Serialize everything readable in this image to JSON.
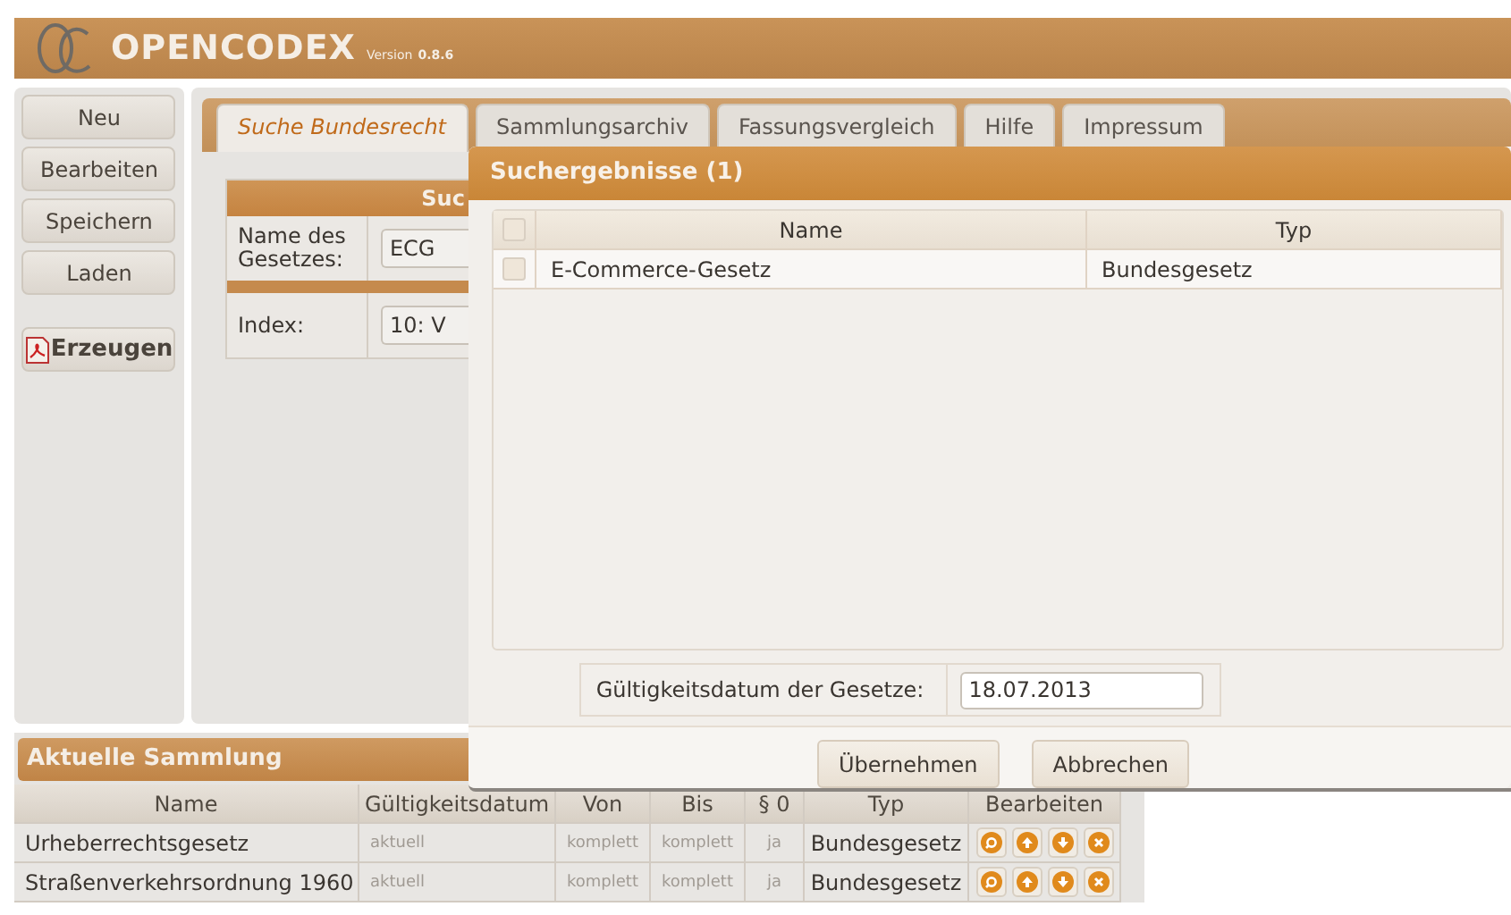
{
  "header": {
    "title": "OPENCODEX",
    "version_label": "Version",
    "version": "0.8.6"
  },
  "sidebar": {
    "buttons": [
      {
        "label": "Neu"
      },
      {
        "label": "Bearbeiten"
      },
      {
        "label": "Speichern"
      },
      {
        "label": "Laden"
      }
    ],
    "generate_button": {
      "label": "Erzeugen"
    }
  },
  "tabs": [
    {
      "label": "Suche Bundesrecht",
      "selected": true
    },
    {
      "label": "Sammlungsarchiv",
      "selected": false
    },
    {
      "label": "Fassungsvergleich",
      "selected": false
    },
    {
      "label": "Hilfe",
      "selected": false
    },
    {
      "label": "Impressum",
      "selected": false
    }
  ],
  "search_form": {
    "heading": "Suc",
    "fields": [
      {
        "label": "Name des Gesetzes:",
        "value": "ECG"
      },
      {
        "label": "Index:",
        "value": "10: V"
      }
    ]
  },
  "collection": {
    "title": "Aktuelle Sammlung",
    "columns": [
      "Name",
      "Gültigkeitsdatum",
      "Von",
      "Bis",
      "§ 0",
      "Typ",
      "Bearbeiten"
    ],
    "rows": [
      {
        "name": "Urheberrechtsgesetz",
        "date": "aktuell",
        "from": "komplett",
        "to": "komplett",
        "p0": "ja",
        "type": "Bundesgesetz"
      },
      {
        "name": "Straßenverkehrsordnung 1960",
        "date": "aktuell",
        "from": "komplett",
        "to": "komplett",
        "p0": "ja",
        "type": "Bundesgesetz"
      }
    ]
  },
  "dialog": {
    "title": "Suchergebnisse (1)",
    "columns": [
      "Name",
      "Typ"
    ],
    "all_checked": false,
    "rows": [
      {
        "name": "E-Commerce-Gesetz",
        "type": "Bundesgesetz",
        "checked": false
      }
    ],
    "date_label": "Gültigkeitsdatum der Gesetze:",
    "date_value": "18.07.2013",
    "buttons": [
      "Übernehmen",
      "Abbrechen"
    ]
  }
}
